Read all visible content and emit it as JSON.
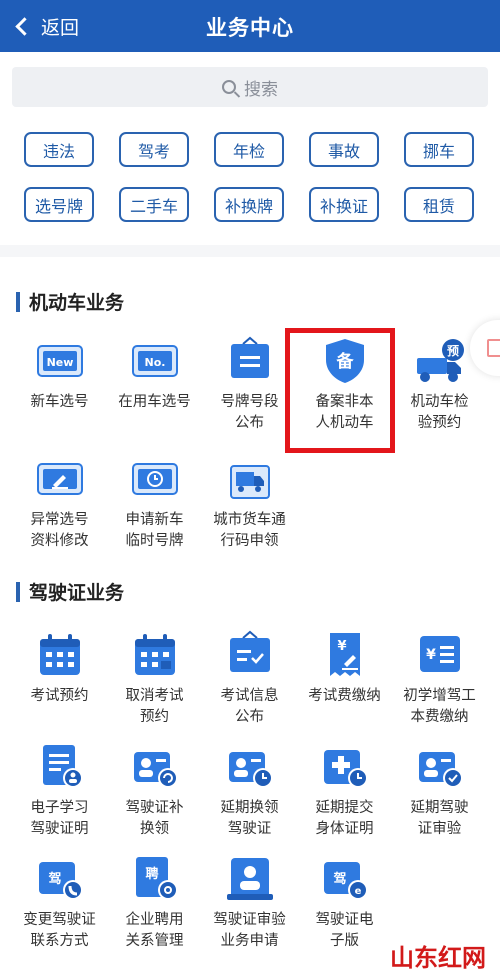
{
  "header": {
    "back_label": "返回",
    "title": "业务中心",
    "bg_color": "#1f5db8"
  },
  "search": {
    "placeholder": "搜索"
  },
  "quick_tags": [
    "违法",
    "驾考",
    "年检",
    "事故",
    "挪车",
    "选号牌",
    "二手车",
    "补换牌",
    "补换证",
    "租赁"
  ],
  "sections": [
    {
      "title": "机动车业务",
      "items": [
        {
          "label": "新车选号",
          "icon": "new-plate-icon",
          "glyph": "New"
        },
        {
          "label": "在用车选号",
          "icon": "no-plate-icon",
          "glyph": "No."
        },
        {
          "label": "号牌号段\n公布",
          "icon": "plate-board-icon",
          "glyph": ""
        },
        {
          "label": "备案非本\n人机动车",
          "icon": "shield-register-icon",
          "glyph": "备"
        },
        {
          "label": "机动车检\n验预约",
          "icon": "truck-booking-icon",
          "glyph": "预"
        },
        {
          "label": "异常选号\n资料修改",
          "icon": "edit-plate-icon",
          "glyph": ""
        },
        {
          "label": "申请新车\n临时号牌",
          "icon": "temp-plate-clock-icon",
          "glyph": ""
        },
        {
          "label": "城市货车通\n行码申领",
          "icon": "cargo-truck-icon",
          "glyph": ""
        }
      ]
    },
    {
      "title": "驾驶证业务",
      "items": [
        {
          "label": "考试预约",
          "icon": "calendar-icon",
          "glyph": ""
        },
        {
          "label": "取消考试\n预约",
          "icon": "calendar-cancel-icon",
          "glyph": ""
        },
        {
          "label": "考试信息\n公布",
          "icon": "exam-board-icon",
          "glyph": ""
        },
        {
          "label": "考试费缴纳",
          "icon": "fee-receipt-icon",
          "glyph": "¥"
        },
        {
          "label": "初学增驾工\n本费缴纳",
          "icon": "cost-card-icon",
          "glyph": "¥"
        },
        {
          "label": "电子学习\n驾驶证明",
          "icon": "e-document-icon",
          "glyph": ""
        },
        {
          "label": "驾驶证补\n换领",
          "icon": "license-renew-icon",
          "glyph": ""
        },
        {
          "label": "延期换领\n驾驶证",
          "icon": "license-clock-icon",
          "glyph": ""
        },
        {
          "label": "延期提交\n身体证明",
          "icon": "medical-clock-icon",
          "glyph": ""
        },
        {
          "label": "延期驾驶\n证审验",
          "icon": "license-check-icon",
          "glyph": ""
        },
        {
          "label": "变更驾驶证\n联系方式",
          "icon": "license-phone-icon",
          "glyph": "驾"
        },
        {
          "label": "企业聘用\n关系管理",
          "icon": "hire-gear-icon",
          "glyph": "聘"
        },
        {
          "label": "驾驶证审验\n业务申请",
          "icon": "review-person-icon",
          "glyph": ""
        },
        {
          "label": "驾驶证电\n子版",
          "icon": "e-license-icon",
          "glyph": "驾"
        }
      ]
    }
  ],
  "watermark": "山东红网",
  "colors": {
    "primary": "#2a63b0",
    "accent_red": "#e3161b"
  }
}
